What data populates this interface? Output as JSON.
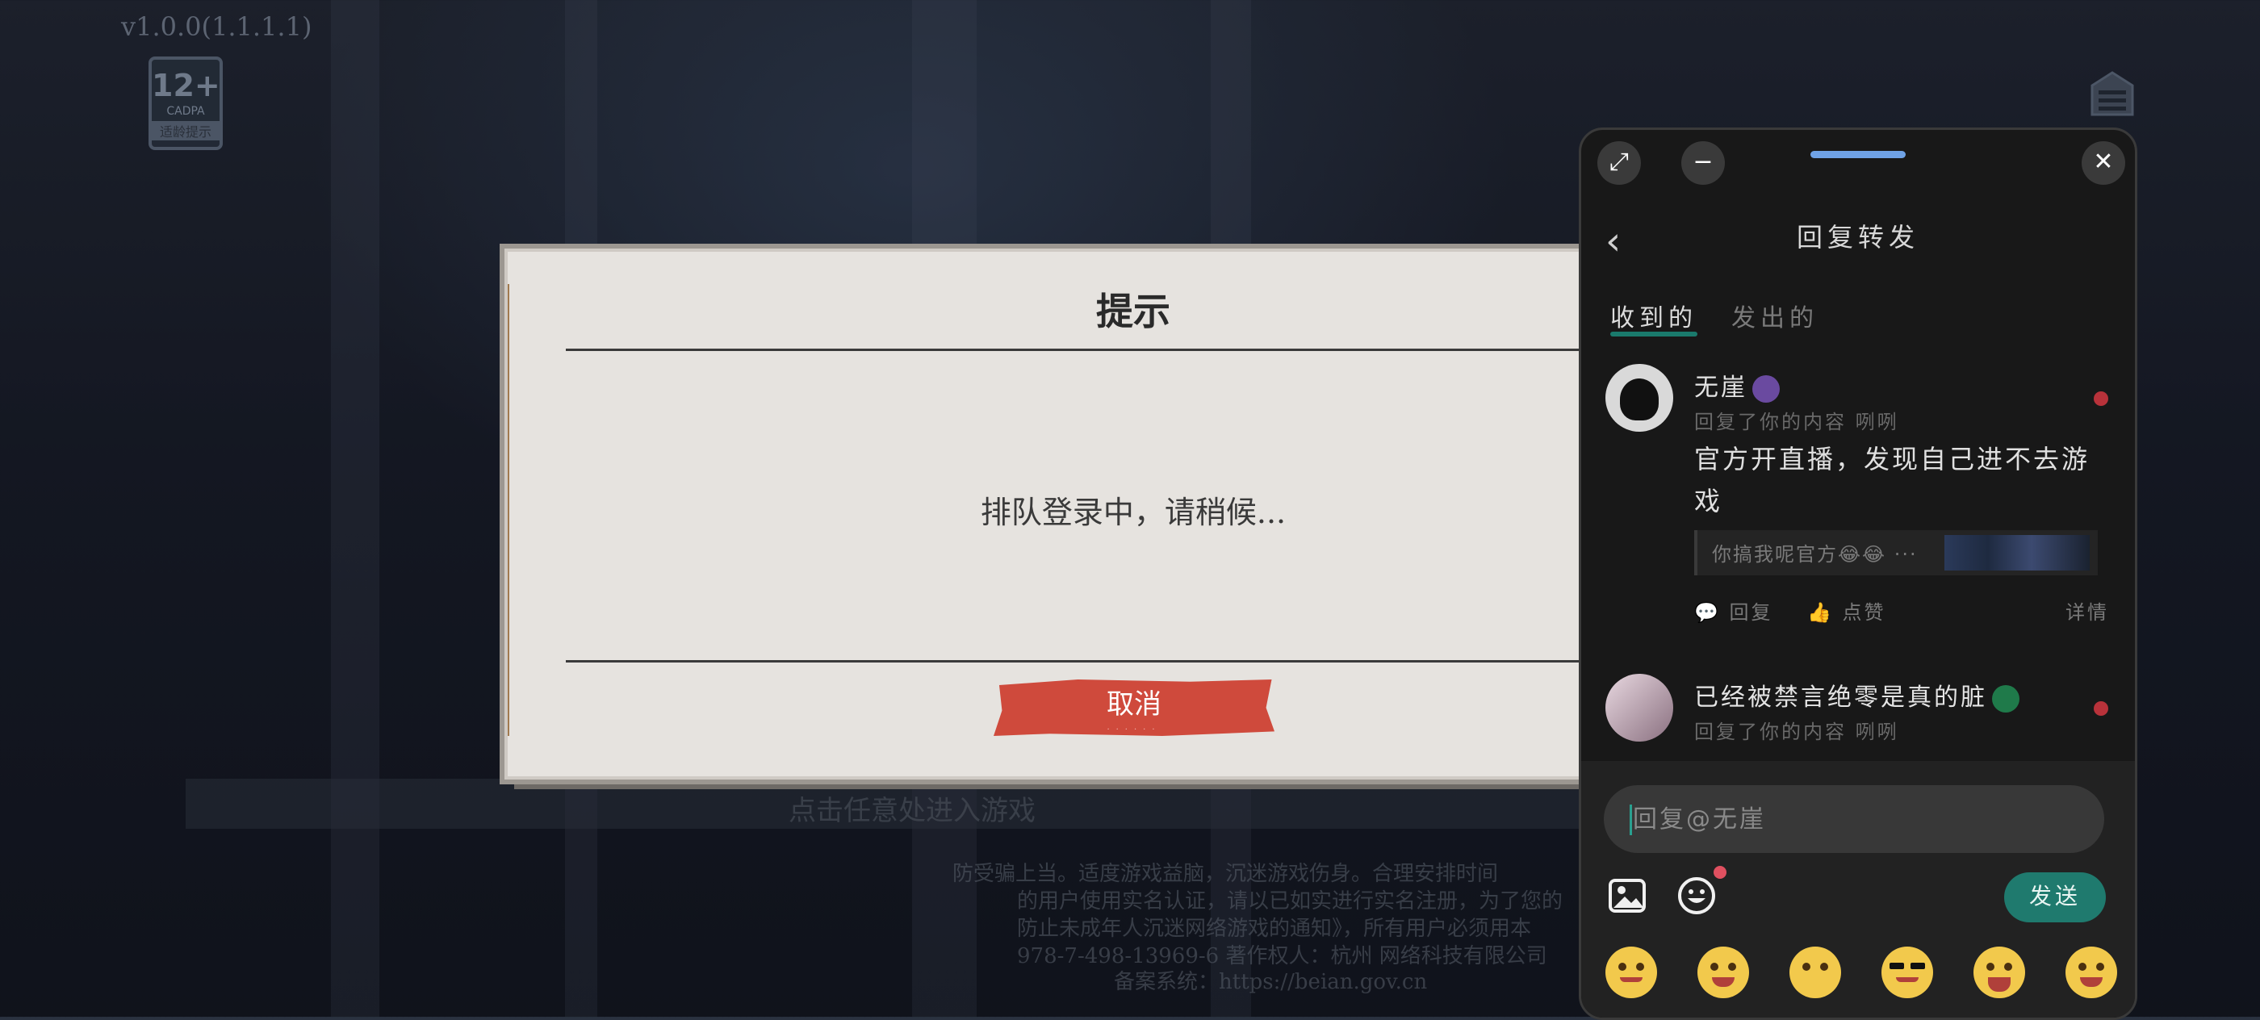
{
  "version": "v1.0.0(1.1.1.1)",
  "age_rating": {
    "number": "12+",
    "org": "CADPA",
    "tip": "适龄提示"
  },
  "background_footer": {
    "lines": [
      "防受骗上当。适度游戏益脑，沉迷游戏伤身。合理安排时间",
      "的用户使用实名认证，请以已如实进行实名注册，为了您的",
      "防止未成年人沉迷网络游戏的通知》，所有用户必须用本",
      "978-7-498-13969-6  著作权人：杭州 网络科技有限公司",
      "备案系统：https://beian.gov.cn"
    ],
    "button_text": "点击任意处进入游戏"
  },
  "dialog": {
    "title": "提示",
    "message": "排队登录中，请稍候...",
    "cancel_label": "取消"
  },
  "panel": {
    "title": "回复转发",
    "tabs": [
      {
        "label": "收到的",
        "active": true
      },
      {
        "label": "发出的",
        "active": false
      }
    ],
    "messages": [
      {
        "username": "无崖",
        "sub": "回复了你的内容 咧咧",
        "content": "官方开直播，发现自己进不去游戏",
        "quote": "你搞我呢官方😂😂 ···",
        "actions": {
          "reply": "回复",
          "like": "点赞",
          "detail": "详情"
        }
      },
      {
        "username": "已经被禁言绝零是真的脏",
        "sub": "回复了你的内容 咧咧"
      }
    ],
    "input": {
      "placeholder": "回复@无崖",
      "value": ""
    },
    "send_label": "发送",
    "emoji_names": [
      "smirk-emoji",
      "love-emoji",
      "peek-emoji",
      "cool-emoji",
      "grin-emoji",
      "joy-emoji"
    ]
  }
}
